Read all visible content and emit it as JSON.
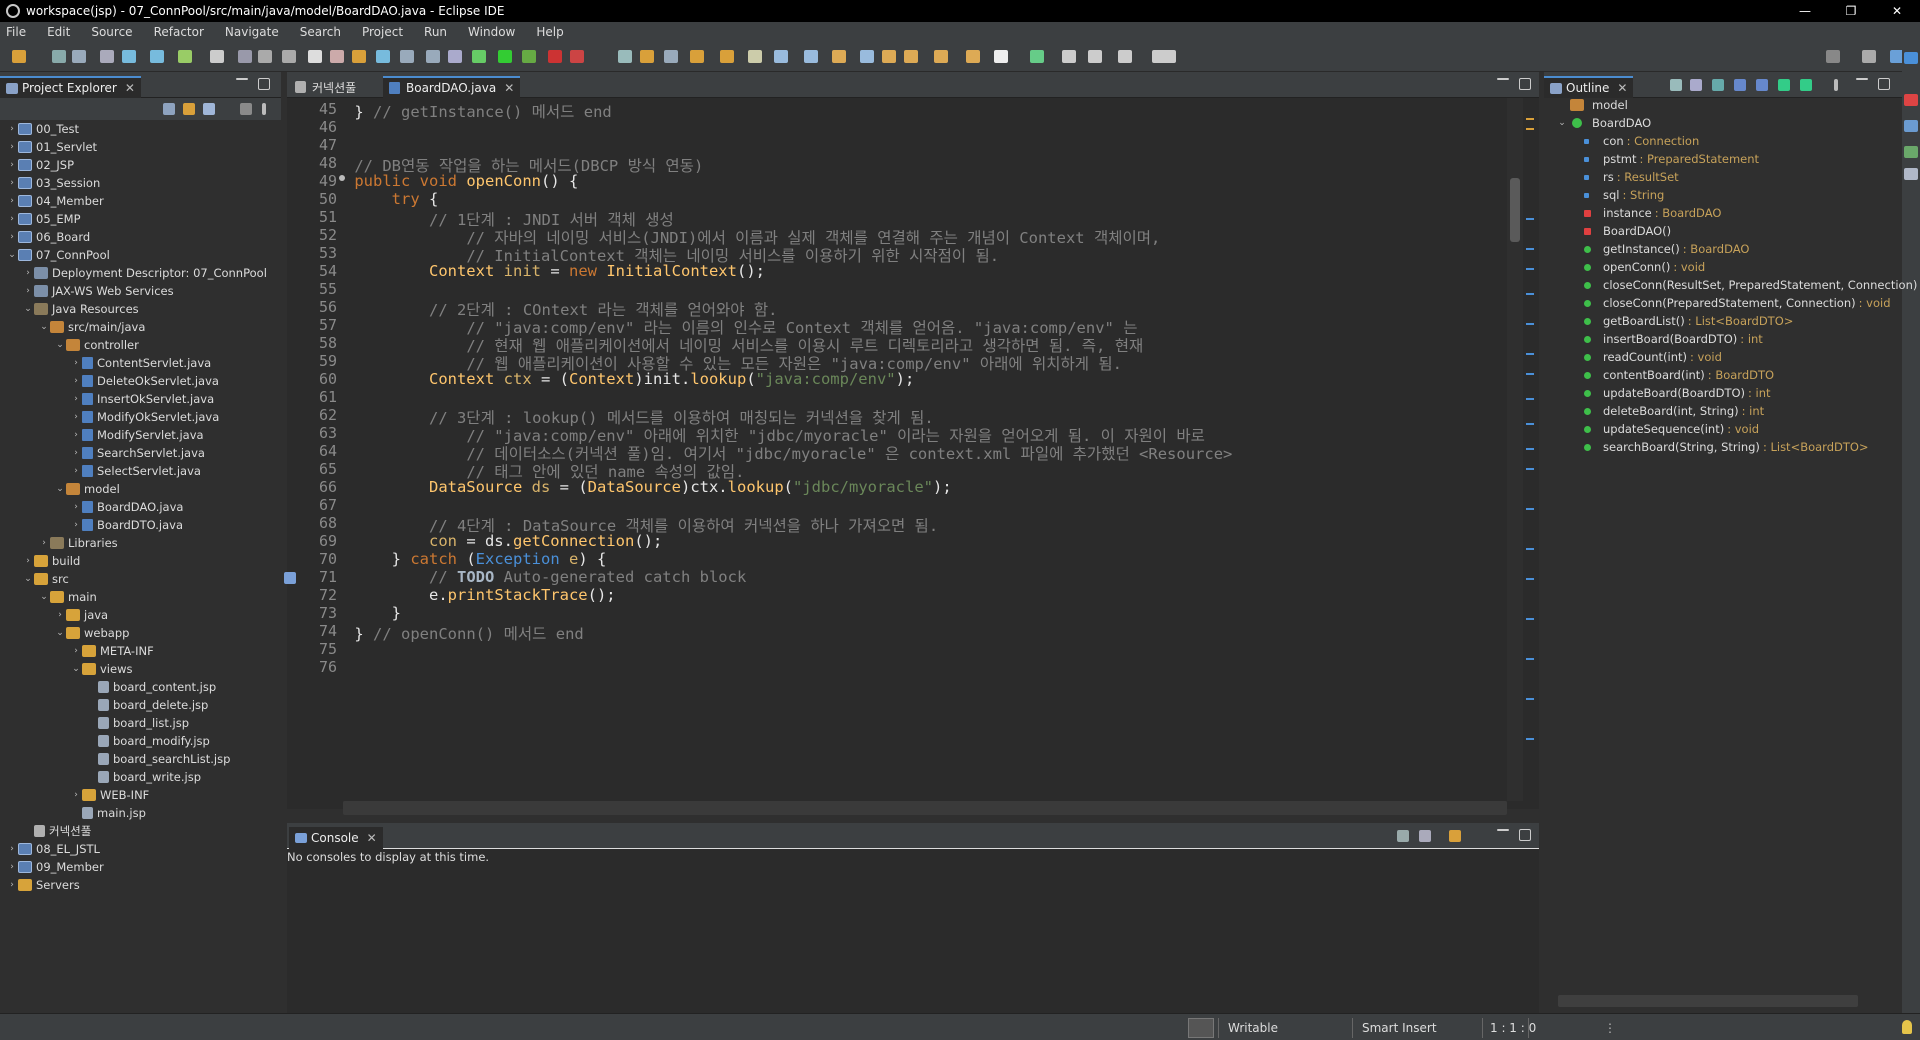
{
  "window": {
    "title": "workspace(jsp) - 07_ConnPool/src/main/java/model/BoardDAO.java - Eclipse IDE",
    "minimize": "—",
    "maximize": "❐",
    "close": "✕"
  },
  "menu": [
    "File",
    "Edit",
    "Source",
    "Refactor",
    "Navigate",
    "Search",
    "Project",
    "Run",
    "Window",
    "Help"
  ],
  "project_explorer": {
    "title": "Project Explorer",
    "close": "✕",
    "items": [
      {
        "label": "00_Test",
        "depth": 0,
        "arrow": "›",
        "icon": "proj"
      },
      {
        "label": "01_Servlet",
        "depth": 0,
        "arrow": "›",
        "icon": "proj"
      },
      {
        "label": "02_JSP",
        "depth": 0,
        "arrow": "›",
        "icon": "proj"
      },
      {
        "label": "03_Session",
        "depth": 0,
        "arrow": "›",
        "icon": "proj"
      },
      {
        "label": "04_Member",
        "depth": 0,
        "arrow": "›",
        "icon": "proj"
      },
      {
        "label": "05_EMP",
        "depth": 0,
        "arrow": "›",
        "icon": "proj"
      },
      {
        "label": "06_Board",
        "depth": 0,
        "arrow": "›",
        "icon": "proj"
      },
      {
        "label": "07_ConnPool",
        "depth": 0,
        "arrow": "⌄",
        "icon": "proj"
      },
      {
        "label": "Deployment Descriptor: 07_ConnPool",
        "depth": 1,
        "arrow": "›",
        "icon": "dd"
      },
      {
        "label": "JAX-WS Web Services",
        "depth": 1,
        "arrow": "›",
        "icon": "dd"
      },
      {
        "label": "Java Resources",
        "depth": 1,
        "arrow": "⌄",
        "icon": "lib"
      },
      {
        "label": "src/main/java",
        "depth": 2,
        "arrow": "⌄",
        "icon": "pkg"
      },
      {
        "label": "controller",
        "depth": 3,
        "arrow": "⌄",
        "icon": "pkg"
      },
      {
        "label": "ContentServlet.java",
        "depth": 4,
        "arrow": "›",
        "icon": "java"
      },
      {
        "label": "DeleteOkServlet.java",
        "depth": 4,
        "arrow": "›",
        "icon": "java"
      },
      {
        "label": "InsertOkServlet.java",
        "depth": 4,
        "arrow": "›",
        "icon": "java"
      },
      {
        "label": "ModifyOkServlet.java",
        "depth": 4,
        "arrow": "›",
        "icon": "java"
      },
      {
        "label": "ModifyServlet.java",
        "depth": 4,
        "arrow": "›",
        "icon": "java"
      },
      {
        "label": "SearchServlet.java",
        "depth": 4,
        "arrow": "›",
        "icon": "java"
      },
      {
        "label": "SelectServlet.java",
        "depth": 4,
        "arrow": "›",
        "icon": "java"
      },
      {
        "label": "model",
        "depth": 3,
        "arrow": "⌄",
        "icon": "pkg"
      },
      {
        "label": "BoardDAO.java",
        "depth": 4,
        "arrow": "›",
        "icon": "java"
      },
      {
        "label": "BoardDTO.java",
        "depth": 4,
        "arrow": "›",
        "icon": "java"
      },
      {
        "label": "Libraries",
        "depth": 2,
        "arrow": "›",
        "icon": "lib"
      },
      {
        "label": "build",
        "depth": 1,
        "arrow": "›",
        "icon": "folder"
      },
      {
        "label": "src",
        "depth": 1,
        "arrow": "⌄",
        "icon": "folder"
      },
      {
        "label": "main",
        "depth": 2,
        "arrow": "⌄",
        "icon": "folder"
      },
      {
        "label": "java",
        "depth": 3,
        "arrow": "›",
        "icon": "folder"
      },
      {
        "label": "webapp",
        "depth": 3,
        "arrow": "⌄",
        "icon": "folder"
      },
      {
        "label": "META-INF",
        "depth": 4,
        "arrow": "›",
        "icon": "folder"
      },
      {
        "label": "views",
        "depth": 4,
        "arrow": "⌄",
        "icon": "folder"
      },
      {
        "label": "board_content.jsp",
        "depth": 5,
        "arrow": "",
        "icon": "jsp"
      },
      {
        "label": "board_delete.jsp",
        "depth": 5,
        "arrow": "",
        "icon": "jsp"
      },
      {
        "label": "board_list.jsp",
        "depth": 5,
        "arrow": "",
        "icon": "jsp"
      },
      {
        "label": "board_modify.jsp",
        "depth": 5,
        "arrow": "",
        "icon": "jsp"
      },
      {
        "label": "board_searchList.jsp",
        "depth": 5,
        "arrow": "",
        "icon": "jsp"
      },
      {
        "label": "board_write.jsp",
        "depth": 5,
        "arrow": "",
        "icon": "jsp"
      },
      {
        "label": "WEB-INF",
        "depth": 4,
        "arrow": "›",
        "icon": "folder"
      },
      {
        "label": "main.jsp",
        "depth": 4,
        "arrow": "",
        "icon": "jsp"
      },
      {
        "label": "커넥션풀",
        "depth": 1,
        "arrow": "",
        "icon": "file"
      },
      {
        "label": "08_EL_JSTL",
        "depth": 0,
        "arrow": "›",
        "icon": "proj"
      },
      {
        "label": "09_Member",
        "depth": 0,
        "arrow": "›",
        "icon": "proj"
      },
      {
        "label": "Servers",
        "depth": 0,
        "arrow": "›",
        "icon": "folder"
      }
    ]
  },
  "editor": {
    "tabs": [
      {
        "label": "커넥션풀",
        "active": false
      },
      {
        "label": "BoardDAO.java",
        "active": true
      }
    ],
    "close": "✕",
    "lines": [
      {
        "n": "45",
        "html": "    <span class=\"ty\">}</span> <span class=\"cm\">// getInstance() 메서드 end</span>"
      },
      {
        "n": "46",
        "html": ""
      },
      {
        "n": "47",
        "html": ""
      },
      {
        "n": "48",
        "html": "    <span class=\"cm\">// DB연동 작업을 하는 메서드(DBCP 방식 연동)</span>"
      },
      {
        "n": "49",
        "html": "    <span class=\"kw\">public</span> <span class=\"kw\">void</span> <span class=\"fn\">openConn</span>() {"
      },
      {
        "n": "50",
        "html": "        <span class=\"kw\">try</span> {"
      },
      {
        "n": "51",
        "html": "            <span class=\"cm\">// 1단계 : JNDI 서버 객체 생성</span>"
      },
      {
        "n": "52",
        "html": "                <span class=\"cm\">// 자바의 네이밍 서비스(JNDI)에서 이름과 실제 객체를 연결해 주는 개념이 Context 객체이며,</span>"
      },
      {
        "n": "53",
        "html": "                <span class=\"cm\">// InitialContext 객체는 네이밍 서비스를 이용하기 위한 시작점이 됨.</span>"
      },
      {
        "n": "54",
        "html": "            <span class=\"fn\">Context</span> <span class=\"vr\">init</span> = <span class=\"kw\">new</span> <span class=\"fn\">InitialContext</span>();"
      },
      {
        "n": "55",
        "html": ""
      },
      {
        "n": "56",
        "html": "            <span class=\"cm\">// 2단계 : COntext 라는 객체를 얻어와야 함.</span>"
      },
      {
        "n": "57",
        "html": "                <span class=\"cm\">// \"java:comp/env\" 라는 이름의 인수로 Context 객체를 얻어옴. \"java:comp/env\" 는</span>"
      },
      {
        "n": "58",
        "html": "                <span class=\"cm\">// 현재 웹 애플리케이션에서 네이밍 서비스를 이용시 루트 디렉토리라고 생각하면 됨. 즉, 현재</span>"
      },
      {
        "n": "59",
        "html": "                <span class=\"cm\">// 웹 애플리케이션이 사용할 수 있는 모든 자원은 \"java:comp/env\" 아래에 위치하게 됨.</span>"
      },
      {
        "n": "60",
        "html": "            <span class=\"fn\">Context</span> <span class=\"vr\">ctx</span> = (<span class=\"fn\">Context</span>)init.<span class=\"fn\">lookup</span>(<span class=\"st\">\"java:comp/env\"</span>);"
      },
      {
        "n": "61",
        "html": ""
      },
      {
        "n": "62",
        "html": "            <span class=\"cm\">// 3단계 : lookup() 메서드를 이용하여 매칭되는 커넥션을 찾게 됨.</span>"
      },
      {
        "n": "63",
        "html": "                <span class=\"cm\">// \"java:comp/env\" 아래에 위치한 \"jdbc/myoracle\" 이라는 자원을 얻어오게 됨. 이 자원이 바로</span>"
      },
      {
        "n": "64",
        "html": "                <span class=\"cm\">// 데이터소스(커넥션 풀)임. 여기서 \"jdbc/myoracle\" 은 context.xml 파일에 추가했던 &lt;Resource&gt;</span>"
      },
      {
        "n": "65",
        "html": "                <span class=\"cm\">// 태그 안에 있던 name 속성의 값임.</span>"
      },
      {
        "n": "66",
        "html": "            <span class=\"fn\">DataSource</span> <span class=\"vr\">ds</span> = (<span class=\"fn\">DataSource</span>)ctx.<span class=\"fn\">lookup</span>(<span class=\"st\">\"jdbc/myoracle\"</span>);"
      },
      {
        "n": "67",
        "html": ""
      },
      {
        "n": "68",
        "html": "            <span class=\"cm\">// 4단계 : DataSource 객체를 이용하여 커넥션을 하나 가져오면 됨.</span>"
      },
      {
        "n": "69",
        "html": "            <span class=\"vr\">con</span> = ds.<span class=\"fn\">getConnection</span>();"
      },
      {
        "n": "70",
        "html": "        } <span class=\"kw\">catch</span> (<span class=\"exc\">Exception</span> <span class=\"vr\">e</span>) {"
      },
      {
        "n": "71",
        "html": "            <span class=\"cm\">// <span class=\"todo\">TODO</span> Auto-generated catch block</span>"
      },
      {
        "n": "72",
        "html": "            e.<span class=\"fn\">printStackTrace</span>();"
      },
      {
        "n": "73",
        "html": "        }"
      },
      {
        "n": "74",
        "html": "    } <span class=\"cm\">// openConn() 메서드 end</span>"
      },
      {
        "n": "75",
        "html": ""
      },
      {
        "n": "76",
        "html": ""
      }
    ]
  },
  "outline": {
    "title": "Outline",
    "close": "✕",
    "items": [
      {
        "label": "model",
        "type": "",
        "kind": "pkg",
        "depth": 0
      },
      {
        "label": "BoardDAO",
        "type": "",
        "kind": "class",
        "depth": 0
      },
      {
        "label": "con",
        "type": " : Connection",
        "kind": "field",
        "depth": 1
      },
      {
        "label": "pstmt",
        "type": " : PreparedStatement",
        "kind": "field",
        "depth": 1
      },
      {
        "label": "rs",
        "type": " : ResultSet",
        "kind": "field",
        "depth": 1
      },
      {
        "label": "sql",
        "type": " : String",
        "kind": "field",
        "depth": 1
      },
      {
        "label": "instance",
        "type": " : BoardDAO",
        "kind": "static",
        "depth": 1
      },
      {
        "label": "BoardDAO()",
        "type": "",
        "kind": "private",
        "depth": 1
      },
      {
        "label": "getInstance()",
        "type": " : BoardDAO",
        "kind": "method",
        "depth": 1
      },
      {
        "label": "openConn()",
        "type": " : void",
        "kind": "method",
        "depth": 1
      },
      {
        "label": "closeConn(ResultSet, PreparedStatement, Connection)",
        "type": " : void",
        "kind": "method",
        "depth": 1
      },
      {
        "label": "closeConn(PreparedStatement, Connection)",
        "type": " : void",
        "kind": "method",
        "depth": 1
      },
      {
        "label": "getBoardList()",
        "type": " : List<BoardDTO>",
        "kind": "method",
        "depth": 1
      },
      {
        "label": "insertBoard(BoardDTO)",
        "type": " : int",
        "kind": "method",
        "depth": 1
      },
      {
        "label": "readCount(int)",
        "type": " : void",
        "kind": "method",
        "depth": 1
      },
      {
        "label": "contentBoard(int)",
        "type": " : BoardDTO",
        "kind": "method",
        "depth": 1
      },
      {
        "label": "updateBoard(BoardDTO)",
        "type": " : int",
        "kind": "method",
        "depth": 1
      },
      {
        "label": "deleteBoard(int, String)",
        "type": " : int",
        "kind": "method",
        "depth": 1
      },
      {
        "label": "updateSequence(int)",
        "type": " : void",
        "kind": "method",
        "depth": 1
      },
      {
        "label": "searchBoard(String, String)",
        "type": " : List<BoardDTO>",
        "kind": "method",
        "depth": 1
      }
    ]
  },
  "console": {
    "title": "Console",
    "close": "✕",
    "message": "No consoles to display at this time."
  },
  "status": {
    "writable": "Writable",
    "insert_mode": "Smart Insert",
    "position": "1 : 1 : 0"
  },
  "colors": {
    "accent": "#4b8ccf",
    "editor_bg": "#2b2b2b",
    "keyword": "#cc7832",
    "comment": "#808080",
    "string": "#6a8759"
  }
}
